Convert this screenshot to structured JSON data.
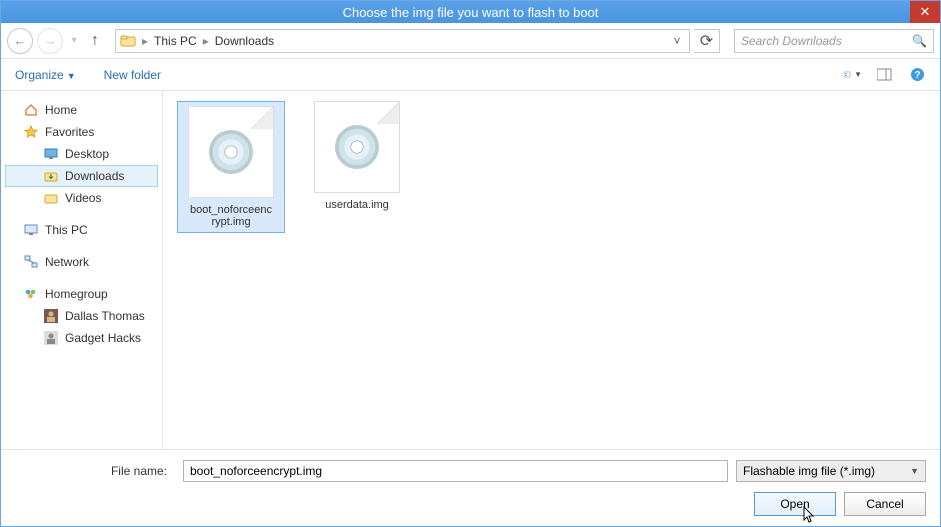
{
  "title": "Choose the img file you want to flash to boot",
  "breadcrumb": {
    "root": "This PC",
    "folder": "Downloads"
  },
  "search_placeholder": "Search Downloads",
  "toolbar": {
    "organize": "Organize",
    "new_folder": "New folder"
  },
  "sidebar": {
    "home": "Home",
    "favorites": "Favorites",
    "fav_items": [
      "Desktop",
      "Downloads",
      "Videos"
    ],
    "this_pc": "This PC",
    "network": "Network",
    "homegroup": "Homegroup",
    "hg_items": [
      "Dallas Thomas",
      "Gadget Hacks"
    ]
  },
  "files": [
    {
      "name": "boot_noforceenc\nrypt.img",
      "selected": true
    },
    {
      "name": "userdata.img",
      "selected": false
    }
  ],
  "footer": {
    "label": "File name:",
    "value": "boot_noforceencrypt.img",
    "filter": "Flashable img file (*.img)",
    "open": "Open",
    "cancel": "Cancel"
  }
}
